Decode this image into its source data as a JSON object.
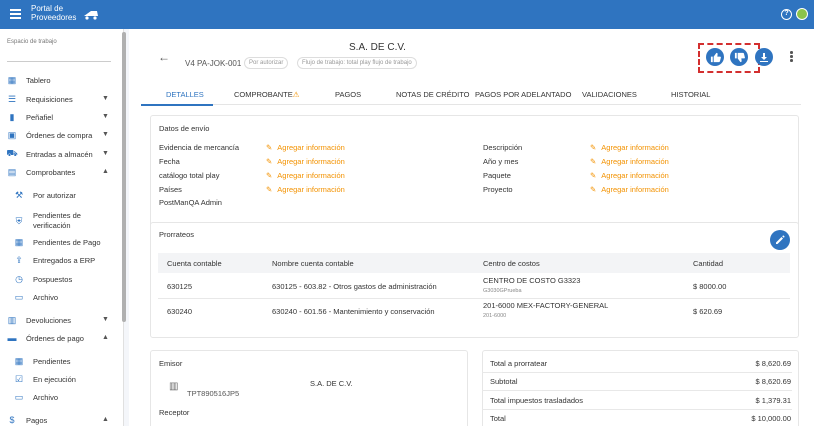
{
  "app": {
    "brand_line1": "Portal de",
    "brand_line2": "Proveedores"
  },
  "sidebar": {
    "workspace_label": "Espacio de trabajo",
    "items": [
      {
        "label": "Tablero"
      },
      {
        "label": "Requisiciones"
      },
      {
        "label": "Peñafiel"
      },
      {
        "label": "Órdenes de compra"
      },
      {
        "label": "Entradas a almacén"
      },
      {
        "label": "Comprobantes"
      },
      {
        "label": "Por autorizar"
      },
      {
        "label": "Pendientes de verificación"
      },
      {
        "label": "Pendientes de Pago"
      },
      {
        "label": "Entregados a ERP"
      },
      {
        "label": "Pospuestos"
      },
      {
        "label": "Archivo"
      },
      {
        "label": "Devoluciones"
      },
      {
        "label": "Órdenes de pago"
      },
      {
        "label": "Pendientes"
      },
      {
        "label": "En ejecución"
      },
      {
        "label": "Archivo"
      },
      {
        "label": "Pagos"
      }
    ]
  },
  "header": {
    "company": "S.A. DE C.V.",
    "doc_id": "V4 PA-JOK-001",
    "status_chip": "Por autorizar",
    "workflow_chip": "Flujo de trabajo: total play flujo de trabajo"
  },
  "tabs": [
    {
      "label": "DETALLES"
    },
    {
      "label": "COMPROBANTE"
    },
    {
      "label": "PAGOS"
    },
    {
      "label": "NOTAS DE CRÉDITO"
    },
    {
      "label": "PAGOS POR ADELANTADO"
    },
    {
      "label": "VALIDACIONES"
    },
    {
      "label": "HISTORIAL"
    }
  ],
  "envio": {
    "title": "Datos de envío",
    "add_label": "Agregar información",
    "left_fields": [
      "Evidencia de mercancía",
      "Fecha",
      "catálogo total play",
      "Países",
      "PostManQA Admin"
    ],
    "right_fields": [
      "Descripción",
      "Año y mes",
      "Paquete",
      "Proyecto"
    ]
  },
  "prorrateos": {
    "title": "Prorrateos",
    "columns": [
      "Cuenta contable",
      "Nombre cuenta contable",
      "Centro de costos",
      "Cantidad"
    ],
    "rows": [
      {
        "cuenta": "630125",
        "nombre": "630125 - 603.82 - Otros gastos de administración",
        "centro": "CENTRO DE COSTO G3323",
        "centro_sub": "G3030GPrueba",
        "cantidad": "$ 8000.00"
      },
      {
        "cuenta": "630240",
        "nombre": "630240 - 601.56 - Mantenimiento y conservación",
        "centro": "201-6000 MEX-FACTORY-GENERAL",
        "centro_sub": "201-6000",
        "cantidad": "$ 620.69"
      }
    ]
  },
  "emisor": {
    "title": "Emisor",
    "rfc": "TPT890516JP5",
    "name": "S.A. DE C.V.",
    "receptor_title": "Receptor"
  },
  "totals": [
    {
      "label": "Total a prorratear",
      "value": "$ 8,620.69"
    },
    {
      "label": "Subtotal",
      "value": "$ 8,620.69"
    },
    {
      "label": "Total impuestos trasladados",
      "value": "$ 1,379.31"
    },
    {
      "label": "Total",
      "value": "$ 10,000.00"
    }
  ],
  "colors": {
    "primary": "#2f74c0",
    "accent": "#f39200",
    "highlight": "#d32f2f"
  }
}
